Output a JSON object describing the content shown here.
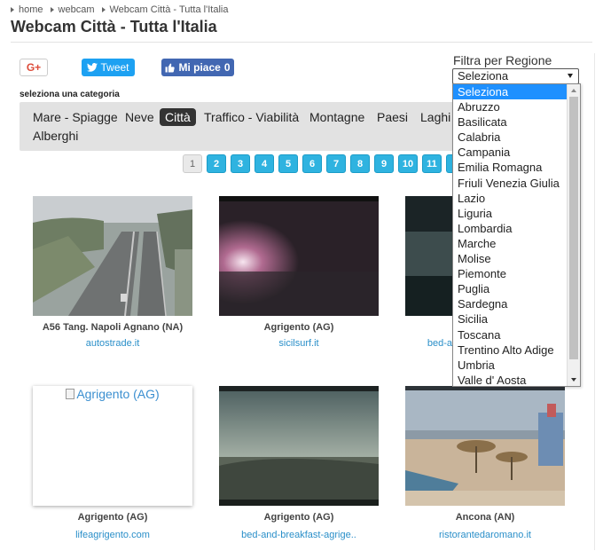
{
  "breadcrumb": [
    "home",
    "webcam",
    "Webcam Città - Tutta l'Italia"
  ],
  "page_title": "Webcam Città - Tutta l'Italia",
  "social": {
    "gplus": "G+",
    "tweet": "Tweet",
    "like": "Mi piace",
    "like_count": "0"
  },
  "filter": {
    "label": "Filtra per Regione",
    "selected": "Seleziona",
    "options": [
      "Seleziona",
      "Abruzzo",
      "Basilicata",
      "Calabria",
      "Campania",
      "Emilia Romagna",
      "Friuli Venezia Giulia",
      "Lazio",
      "Liguria",
      "Lombardia",
      "Marche",
      "Molise",
      "Piemonte",
      "Puglia",
      "Sardegna",
      "Sicilia",
      "Toscana",
      "Trentino Alto Adige",
      "Umbria",
      "Valle d' Aosta"
    ]
  },
  "categories": {
    "label": "seleziona una categoria",
    "items": [
      "Mare - Spiagge",
      "Neve",
      "Città",
      "Traffico - Viabilità",
      "Montagne",
      "Paesi",
      "Laghi",
      "Alberghi"
    ],
    "active": "Città"
  },
  "pagination": [
    "1",
    "2",
    "3",
    "4",
    "5",
    "6",
    "7",
    "8",
    "9",
    "10",
    "11",
    "1"
  ],
  "pagination_current": "1",
  "webcams": [
    {
      "title": "A56 Tang. Napoli Agnano (NA)",
      "source": "autostrade.it"
    },
    {
      "title": "Agrigento (AG)",
      "source": "sicilsurf.it"
    },
    {
      "title": "",
      "source": "bed-a"
    },
    {
      "title": "Agrigento (AG)",
      "source": "lifeagrigento.com",
      "alt_text": "Agrigento (AG)"
    },
    {
      "title": "Agrigento (AG)",
      "source": "bed-and-breakfast-agrige.."
    },
    {
      "title": "Ancona (AN)",
      "source": "ristorantedaromano.it"
    }
  ],
  "colors": {
    "link": "#2a8fc9",
    "pager_active": "#2fb3e0",
    "select_highlight": "#1e90ff",
    "tweet": "#1da1f2",
    "facebook": "#4267b2"
  }
}
